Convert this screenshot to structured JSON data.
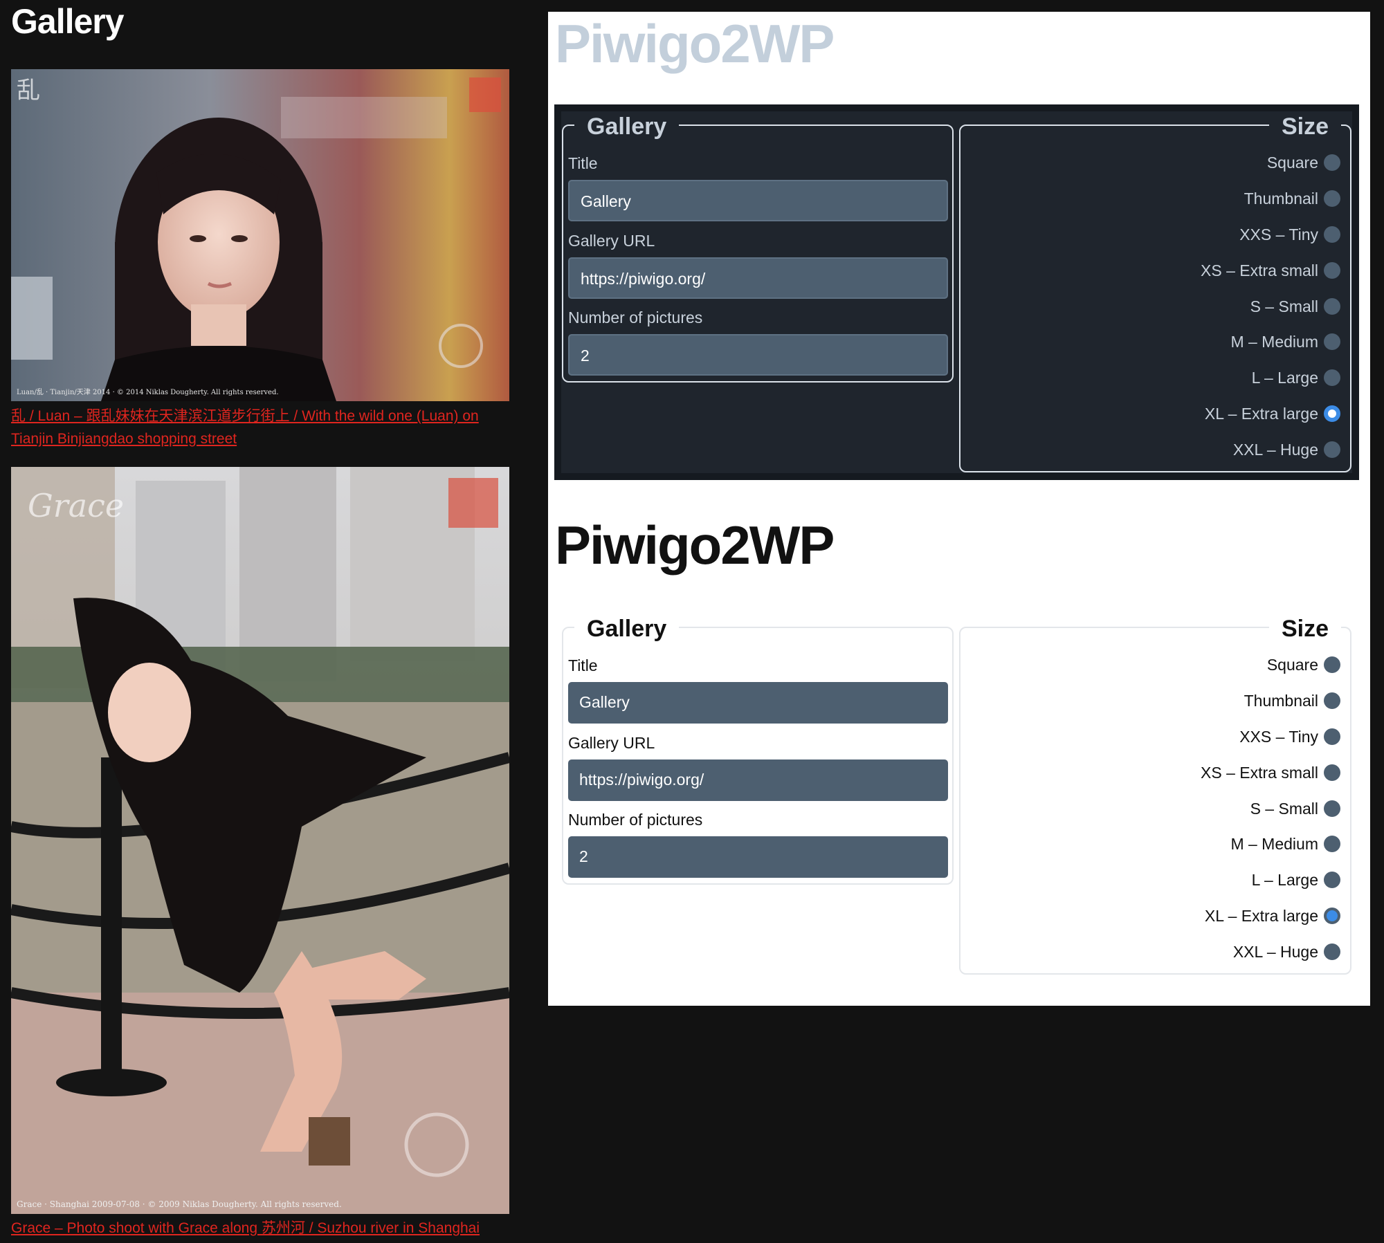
{
  "gallery": {
    "title": "Gallery",
    "photos": [
      {
        "caption": "乱 / Luan – 跟乱妹妹在天津滨江道步行街上 / With the wild one (Luan) on Tianjin Binjiangdao shopping street",
        "image_text": "Luan/乱 · Tianjin/天津 2014 · © 2014 Niklas Dougherty. All rights reserved.",
        "watermark": "乱"
      },
      {
        "caption": "Grace – Photo shoot with Grace along 苏州河 / Suzhou river in Shanghai",
        "image_text": "Grace · Shanghai 2009-07-08 · © 2009 Niklas Dougherty. All rights reserved.",
        "watermark": "Grace"
      }
    ]
  },
  "panels": {
    "dark": {
      "brand": "Piwigo2WP",
      "gallery_legend": "Gallery",
      "title_label": "Title",
      "title_value": "Gallery",
      "url_label": "Gallery URL",
      "url_value": "https://piwigo.org/",
      "count_label": "Number of pictures",
      "count_value": "2",
      "size_legend": "Size",
      "sizes": [
        "Square",
        "Thumbnail",
        "XXS – Tiny",
        "XS – Extra small",
        "S – Small",
        "M – Medium",
        "L – Large",
        "XL – Extra large",
        "XXL – Huge"
      ],
      "selected_size": "XL – Extra large"
    },
    "light": {
      "brand": "Piwigo2WP",
      "gallery_legend": "Gallery",
      "title_label": "Title",
      "title_value": "Gallery",
      "url_label": "Gallery URL",
      "url_value": "https://piwigo.org/",
      "count_label": "Number of pictures",
      "count_value": "2",
      "size_legend": "Size",
      "sizes": [
        "Square",
        "Thumbnail",
        "XXS – Tiny",
        "XS – Extra small",
        "S – Small",
        "M – Medium",
        "L – Large",
        "XL – Extra large",
        "XXL – Huge"
      ],
      "selected_size": "XL – Extra large"
    }
  },
  "colors": {
    "page_background": "#121212",
    "caption_link": "#e0251f",
    "dark_brand": "#c3cfdb",
    "light_brand": "#111111",
    "input_background": "#4d5f70",
    "radio_checked": "#3c8ce6"
  }
}
